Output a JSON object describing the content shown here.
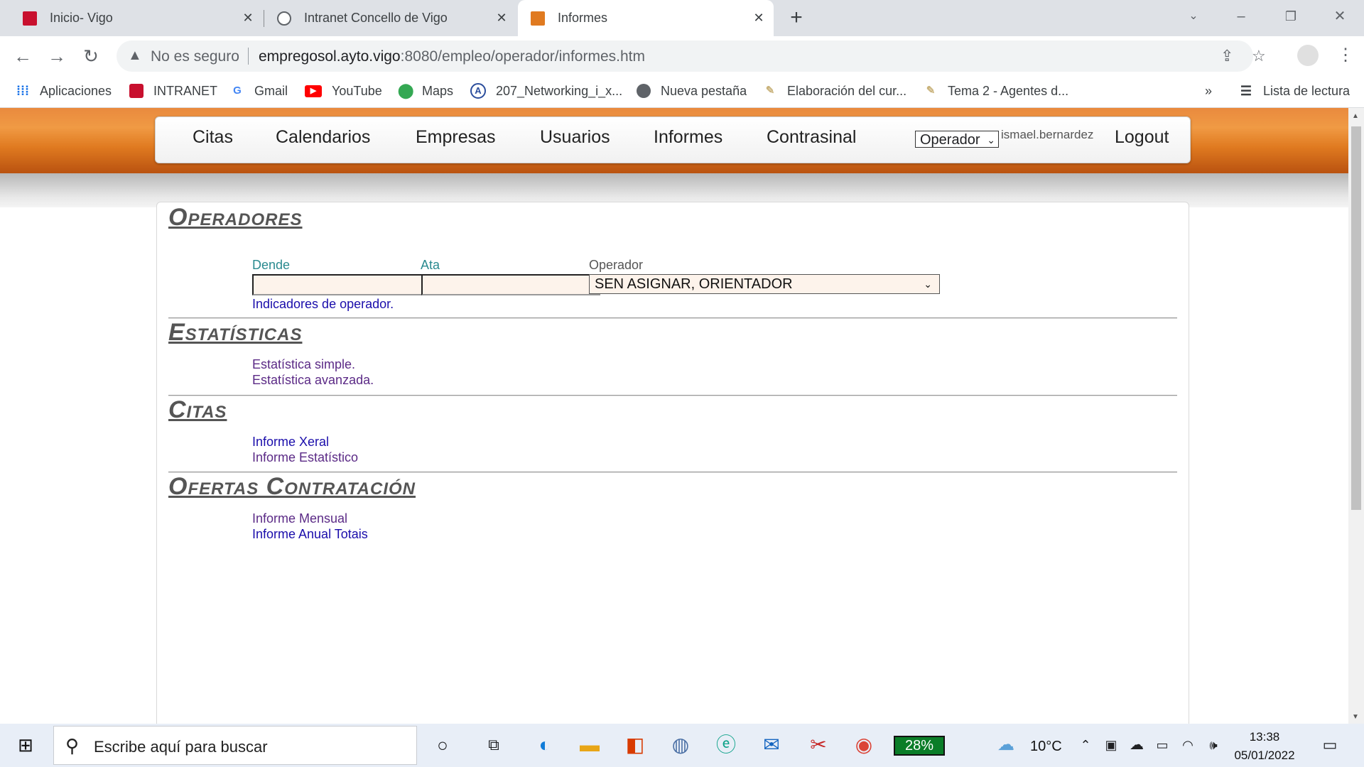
{
  "browser": {
    "tabs": [
      {
        "title": "Inicio- Vigo",
        "favicon_color": "#c8102e"
      },
      {
        "title": "Intranet Concello de Vigo",
        "favicon_color": "#5f6368"
      },
      {
        "title": "Informes",
        "favicon_color": "#e07a20"
      }
    ],
    "address": {
      "security": "No es seguro",
      "host": "empregosol.ayto.vigo",
      "path": ":8080/empleo/operador/informes.htm"
    },
    "bookmarks": [
      {
        "label": "Aplicaciones",
        "icon": "apps-grid-icon"
      },
      {
        "label": "INTRANET",
        "icon": "vigo-icon"
      },
      {
        "label": "Gmail",
        "icon": "google-icon"
      },
      {
        "label": "YouTube",
        "icon": "youtube-icon"
      },
      {
        "label": "Maps",
        "icon": "maps-icon"
      },
      {
        "label": "207_Networking_i_x...",
        "icon": "networking-icon"
      },
      {
        "label": "Nueva pestaña",
        "icon": "globe-icon"
      },
      {
        "label": "Elaboración del cur...",
        "icon": "document-icon"
      },
      {
        "label": "Tema 2 - Agentes d...",
        "icon": "document-icon"
      }
    ],
    "reading_list": "Lista de lectura",
    "more": "»"
  },
  "menu": {
    "items": [
      "Citas",
      "Calendarios",
      "Empresas",
      "Usuarios",
      "Informes",
      "Contrasinal"
    ],
    "role": "Operador",
    "user": "ismael.bernardez",
    "logout": "Logout"
  },
  "sections": {
    "operadores": {
      "title": "Operadores",
      "from_label": "Dende",
      "to_label": "Ata",
      "operator_label": "Operador",
      "operator_value": "SEN ASIGNAR, ORIENTADOR",
      "link": "Indicadores de operador."
    },
    "estatisticas": {
      "title": "Estatísticas",
      "links": [
        "Estatística simple.",
        "Estatística avanzada."
      ]
    },
    "citas": {
      "title": "Citas",
      "links": [
        "Informe Xeral",
        "Informe Estatístico"
      ]
    },
    "ofertas": {
      "title": "Ofertas Contratación",
      "links": [
        "Informe Mensual",
        "Informe Anual Totais"
      ]
    }
  },
  "taskbar": {
    "search_placeholder": "Escribe aquí para buscar",
    "battery": "28%",
    "weather": "10°C",
    "time": "13:38",
    "date": "05/01/2022"
  }
}
